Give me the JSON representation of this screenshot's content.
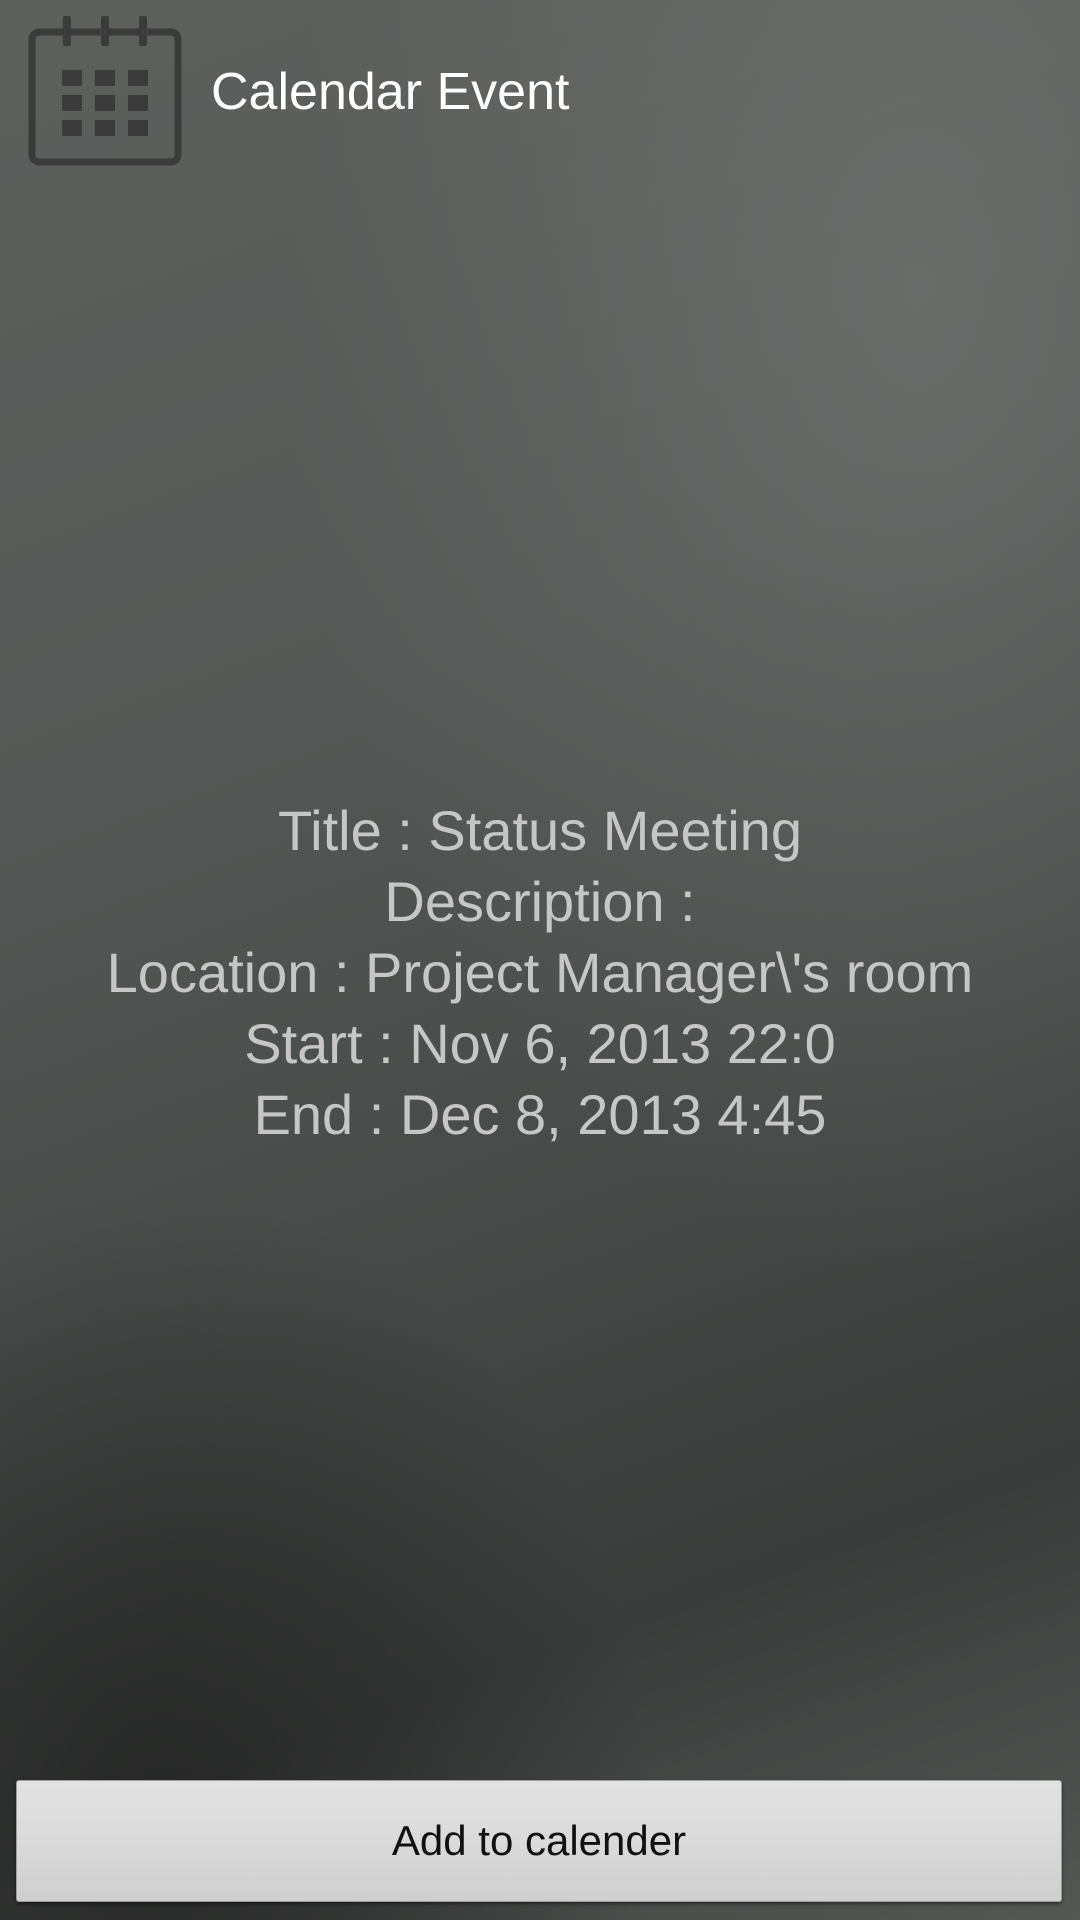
{
  "header": {
    "icon": "calendar-icon",
    "title": "Calendar Event"
  },
  "event": {
    "title": "Title : Status Meeting",
    "description": "Description :",
    "location": "Location : Project Manager\\'s room",
    "start": "Start : Nov 6, 2013 22:0",
    "end": "End : Dec 8, 2013 4:45"
  },
  "actions": {
    "add_label": "Add to calender"
  },
  "colors": {
    "icon": "#3a3b3a",
    "title_text": "#ffffff",
    "detail_text": "#c6c6c6",
    "button_bg": "#dadada",
    "button_text": "#111111"
  }
}
